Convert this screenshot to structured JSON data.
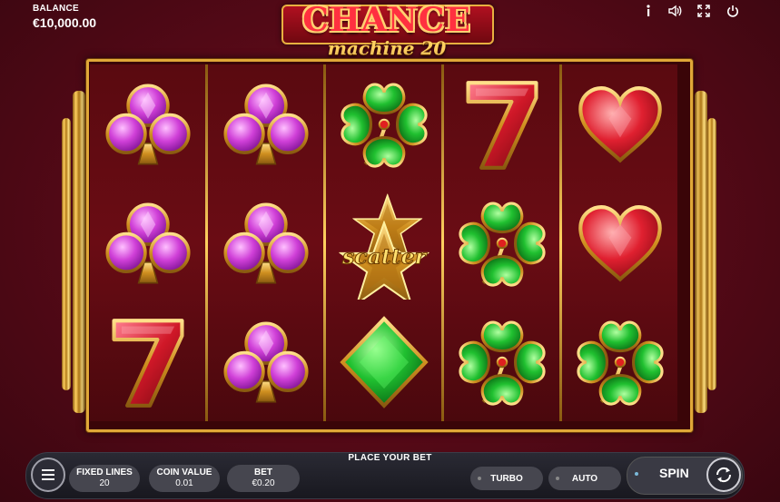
{
  "topbar": {
    "balance_label": "BALANCE",
    "balance_value": "€10,000.00",
    "icons": [
      "info-icon",
      "volume-icon",
      "fullscreen-icon",
      "power-icon"
    ]
  },
  "logo": {
    "line1": "CHANCE",
    "line2": "machine 20"
  },
  "reels": {
    "columns": [
      [
        "club",
        "club",
        "seven"
      ],
      [
        "club",
        "club",
        "club"
      ],
      [
        "clover",
        "scatter",
        "diamond"
      ],
      [
        "seven",
        "clover",
        "clover"
      ],
      [
        "heart",
        "heart",
        "clover"
      ]
    ],
    "scatter_text": "scatter"
  },
  "controls": {
    "place_bet": "PLACE YOUR BET",
    "fixed_lines_label": "FIXED LINES",
    "fixed_lines_value": "20",
    "coin_value_label": "COIN VALUE",
    "coin_value_value": "0.01",
    "bet_label": "BET",
    "bet_value": "€0.20",
    "turbo_label": "TURBO",
    "auto_label": "AUTO",
    "spin_label": "SPIN"
  },
  "colors": {
    "background": "#5a0a18",
    "frame_gold": "#e0a838",
    "club_purple": "#d040d8",
    "clover_green": "#20c030",
    "heart_red": "#e02030",
    "seven_red": "#d01828",
    "panel": "#1e1e26"
  }
}
